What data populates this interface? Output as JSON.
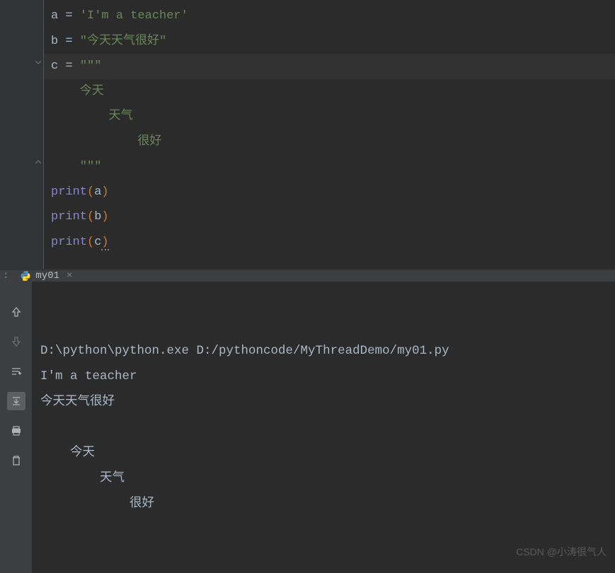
{
  "editor": {
    "lines": [
      {
        "segments": [
          {
            "text": "a ",
            "cls": "var"
          },
          {
            "text": "=",
            "cls": "op"
          },
          {
            "text": " ",
            "cls": ""
          },
          {
            "text": "'I'm a teacher'",
            "cls": "string"
          }
        ]
      },
      {
        "segments": [
          {
            "text": "b ",
            "cls": "var"
          },
          {
            "text": "=",
            "cls": "op"
          },
          {
            "text": " ",
            "cls": ""
          },
          {
            "text": "\"今天天气很好\"",
            "cls": "string"
          }
        ]
      },
      {
        "highlighted": true,
        "segments": [
          {
            "text": "c ",
            "cls": "var"
          },
          {
            "text": "=",
            "cls": "op"
          },
          {
            "text": " ",
            "cls": ""
          },
          {
            "text": "\"\"\"",
            "cls": "string"
          }
        ]
      },
      {
        "segments": [
          {
            "text": "    今天",
            "cls": "string"
          }
        ]
      },
      {
        "segments": [
          {
            "text": "        天气",
            "cls": "string"
          }
        ]
      },
      {
        "segments": [
          {
            "text": "            很好",
            "cls": "string"
          }
        ]
      },
      {
        "segments": [
          {
            "text": "    \"\"\"",
            "cls": "string"
          }
        ]
      },
      {
        "segments": [
          {
            "text": "print",
            "cls": "builtin"
          },
          {
            "text": "(",
            "cls": "paren"
          },
          {
            "text": "a",
            "cls": "param"
          },
          {
            "text": ")",
            "cls": "paren"
          }
        ]
      },
      {
        "segments": [
          {
            "text": "print",
            "cls": "builtin"
          },
          {
            "text": "(",
            "cls": "paren"
          },
          {
            "text": "b",
            "cls": "param"
          },
          {
            "text": ")",
            "cls": "paren"
          }
        ]
      },
      {
        "segments": [
          {
            "text": "print",
            "cls": "builtin"
          },
          {
            "text": "(",
            "cls": "paren"
          },
          {
            "text": "c",
            "cls": "param"
          },
          {
            "text": ")",
            "cls": "paren squiggle"
          }
        ]
      }
    ]
  },
  "runTab": {
    "prefix": ":",
    "name": "my01",
    "close": "×"
  },
  "console": {
    "lines": [
      "D:\\python\\python.exe D:/pythoncode/MyThreadDemo/my01.py",
      "I'm a teacher",
      "今天天气很好",
      "",
      "    今天",
      "        天气",
      "            很好"
    ]
  },
  "watermark": "CSDN @小涛很气人"
}
